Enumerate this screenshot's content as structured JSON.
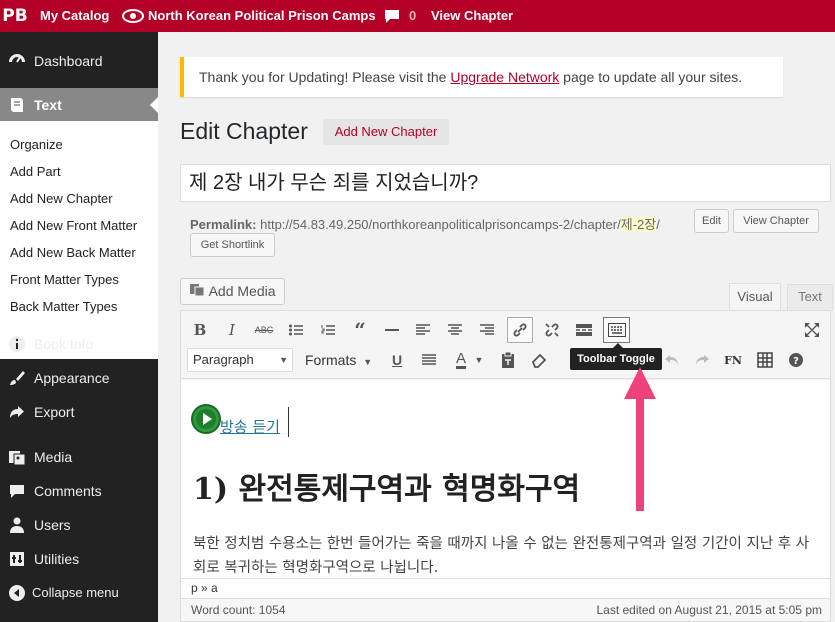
{
  "adminbar": {
    "logo": "PB",
    "my_catalog": "My Catalog",
    "book_title": "North Korean Political Prison Camps",
    "comments_count": "0",
    "view_chapter": "View Chapter"
  },
  "sidebar": {
    "dashboard": "Dashboard",
    "text": "Text",
    "submenu": [
      "Organize",
      "Add Part",
      "Add New Chapter",
      "Add New Front Matter",
      "Add New Back Matter",
      "Front Matter Types",
      "Back Matter Types"
    ],
    "book_info": "Book Info",
    "appearance": "Appearance",
    "export": "Export",
    "media": "Media",
    "comments": "Comments",
    "users": "Users",
    "utilities": "Utilities",
    "collapse": "Collapse menu"
  },
  "notice": {
    "before": "Thank you for Updating! Please visit the ",
    "link": "Upgrade Network",
    "after": " page to update all your sites."
  },
  "page": {
    "heading": "Edit Chapter",
    "add_new": "Add New Chapter"
  },
  "post": {
    "title": "제 2장 내가 무슨 죄를 지었습니까?",
    "permalink_label": "Permalink:",
    "permalink_base": "http://54.83.49.250/northkoreanpoliticalprisoncamps-2/chapter/",
    "permalink_slug": "제-2장",
    "permalink_end": "/",
    "edit_btn": "Edit",
    "view_btn": "View Chapter",
    "shortlink_btn": "Get Shortlink"
  },
  "editor": {
    "add_media": "Add Media",
    "tab_visual": "Visual",
    "tab_text": "Text",
    "format_select": "Paragraph",
    "formats_menu": "Formats",
    "fn_label": "FN",
    "tooltip": "Toolbar Toggle",
    "audio_link": "방송 듣기",
    "h1": "1) 완전통제구역과 혁명화구역",
    "paragraph": "북한 정치범 수용소는 한번 들어가는 죽을 때까지 나올 수 없는 완전통제구역과 일정 기간이 지난 후 사회로 복귀하는 혁명화구역으로 나뉩니다.",
    "path": "p » a",
    "word_count": "Word count: 1054",
    "last_edited": "Last edited on August 21, 2015 at 5:05 pm"
  },
  "colors": {
    "brand": "#b40026",
    "annotation_arrow": "#f0427a",
    "notice_border": "#ffba00"
  }
}
